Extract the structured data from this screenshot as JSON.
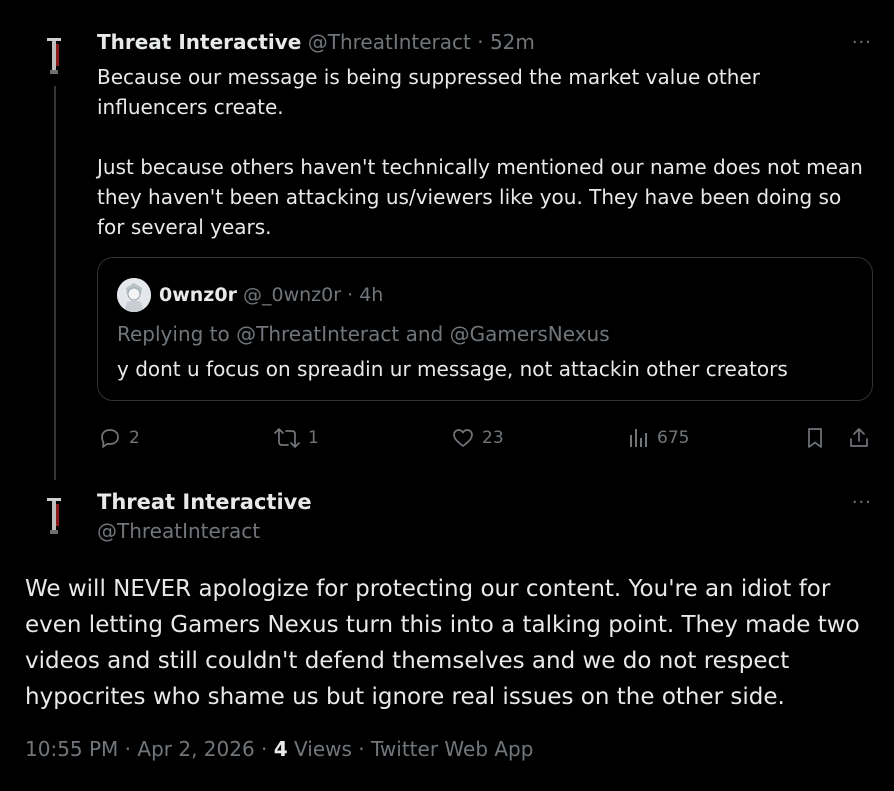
{
  "tweet1": {
    "author_name": "Threat Interactive",
    "author_handle": "@ThreatInteract",
    "time_ago": "52m",
    "body": "Because our message is being suppressed the market value other influencers create.\n\nJust because others haven't technically mentioned our name does not mean they haven't been attacking us/viewers like you. They have been doing so for several years.",
    "quote": {
      "author_name": "0wnz0r",
      "author_handle": "@_0wnz0r",
      "time_ago": "4h",
      "replying_prefix": "Replying to",
      "replying_user1": "@ThreatInteract",
      "replying_and": "and",
      "replying_user2": "@GamersNexus",
      "body": "y dont u focus on spreadin ur message, not attackin other creators"
    },
    "actions": {
      "replies": "2",
      "retweets": "1",
      "likes": "23",
      "views": "675"
    }
  },
  "tweet2": {
    "author_name": "Threat Interactive",
    "author_handle": "@ThreatInteract",
    "body": "We will NEVER apologize for protecting our content. You're an idiot for even letting Gamers Nexus turn this into a talking point. They made two videos and still couldn't defend themselves and we do not respect hypocrites who shame us but ignore real issues on the other side.",
    "time": "10:55 PM",
    "date": "Apr 2, 2026",
    "views_count": "4",
    "views_label": "Views",
    "source": "Twitter Web App"
  },
  "more_label": "···",
  "separator": "·",
  "colors": {
    "background": "#000000",
    "text": "#e7e9ea",
    "muted": "#71767b",
    "border": "#2f3336",
    "accent_red": "#c0392b"
  }
}
